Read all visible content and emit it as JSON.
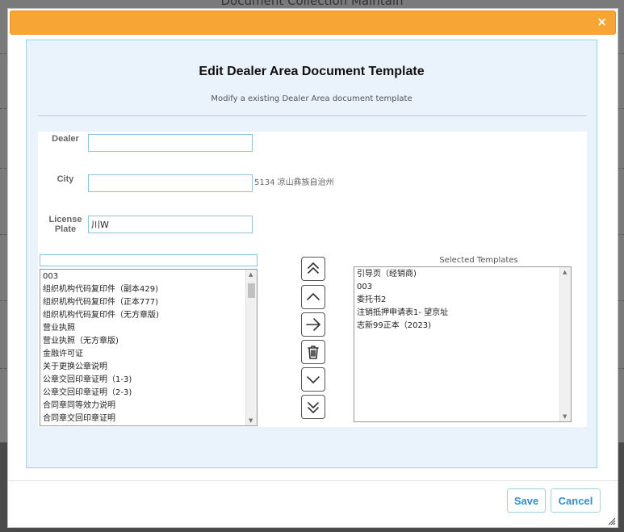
{
  "background": {
    "page_title": "Document Collection Maintain"
  },
  "dialog": {
    "close_glyph": "×",
    "title": "Edit Dealer Area Document Template",
    "subtitle": "Modify a existing Dealer Area document template"
  },
  "form": {
    "dealer": {
      "label": "Dealer",
      "value": ""
    },
    "city": {
      "label": "City",
      "value": "",
      "display_name": "5134 凉山彝族自治州"
    },
    "license_plate": {
      "label_line1": "License",
      "label_line2": "Plate",
      "value": "川W"
    }
  },
  "available_templates": {
    "filter_value": "",
    "items": [
      "003",
      "组织机构代码复印件（副本429)",
      "组织机构代码复印件（正本777)",
      "组织机构代码复印件（无方章版)",
      "营业执照",
      "营业执照（无方章版)",
      "金融许可证",
      "关于更换公章说明",
      "公章交回印章证明（1-3)",
      "公章交回印章证明（2-3)",
      "合同章同等效力说明",
      "合同章交回印章证明"
    ]
  },
  "selected_templates": {
    "label": "Selected Templates",
    "items": [
      "引导页（经销商)",
      "003",
      "委托书2",
      "注销抵押申请表1- 望京址",
      "志新99正本（2023)"
    ]
  },
  "move_buttons": [
    {
      "name": "move-top-button",
      "icon": "double-chevron-up-icon"
    },
    {
      "name": "move-up-button",
      "icon": "chevron-up-icon"
    },
    {
      "name": "add-to-selected-button",
      "icon": "arrow-right-icon"
    },
    {
      "name": "remove-button",
      "icon": "trash-icon"
    },
    {
      "name": "move-down-button",
      "icon": "chevron-down-icon"
    },
    {
      "name": "move-bottom-button",
      "icon": "double-chevron-down-icon"
    }
  ],
  "footer": {
    "save_label": "Save",
    "cancel_label": "Cancel"
  }
}
